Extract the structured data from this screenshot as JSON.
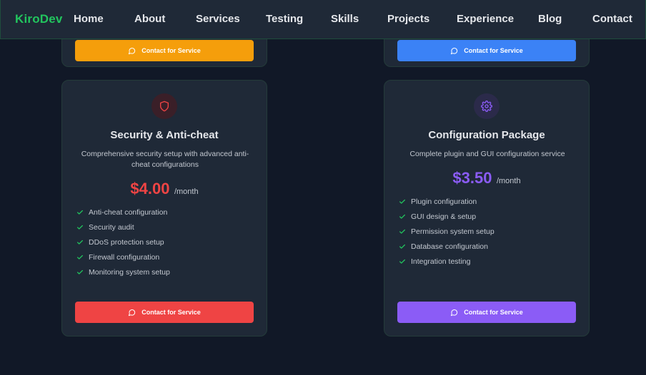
{
  "nav": {
    "logo": "KiroDev",
    "items": [
      "Home",
      "About",
      "Services",
      "Testing",
      "Skills",
      "Projects",
      "Experience",
      "Blog",
      "Contact"
    ]
  },
  "top_cards": {
    "left_button": "Contact for Service",
    "right_button": "Contact for Service"
  },
  "cards": [
    {
      "icon": "shield-icon",
      "title": "Security & Anti-cheat",
      "description": "Comprehensive security setup with advanced anti-cheat configurations",
      "price": "$4.00",
      "period": "/month",
      "features": [
        "Anti-cheat configuration",
        "Security audit",
        "DDoS protection setup",
        "Firewall configuration",
        "Monitoring system setup"
      ],
      "button": "Contact for Service",
      "accent": "#ef4444"
    },
    {
      "icon": "gear-icon",
      "title": "Configuration Package",
      "description": "Complete plugin and GUI configuration service",
      "price": "$3.50",
      "period": "/month",
      "features": [
        "Plugin configuration",
        "GUI design & setup",
        "Permission system setup",
        "Database configuration",
        "Integration testing"
      ],
      "button": "Contact for Service",
      "accent": "#8b5cf6"
    }
  ],
  "colors": {
    "background": "#111827",
    "card": "#1f2937",
    "check": "#22c55e",
    "orange": "#f59e0b",
    "blue": "#3b82f6",
    "red": "#ef4444",
    "purple": "#8b5cf6"
  }
}
